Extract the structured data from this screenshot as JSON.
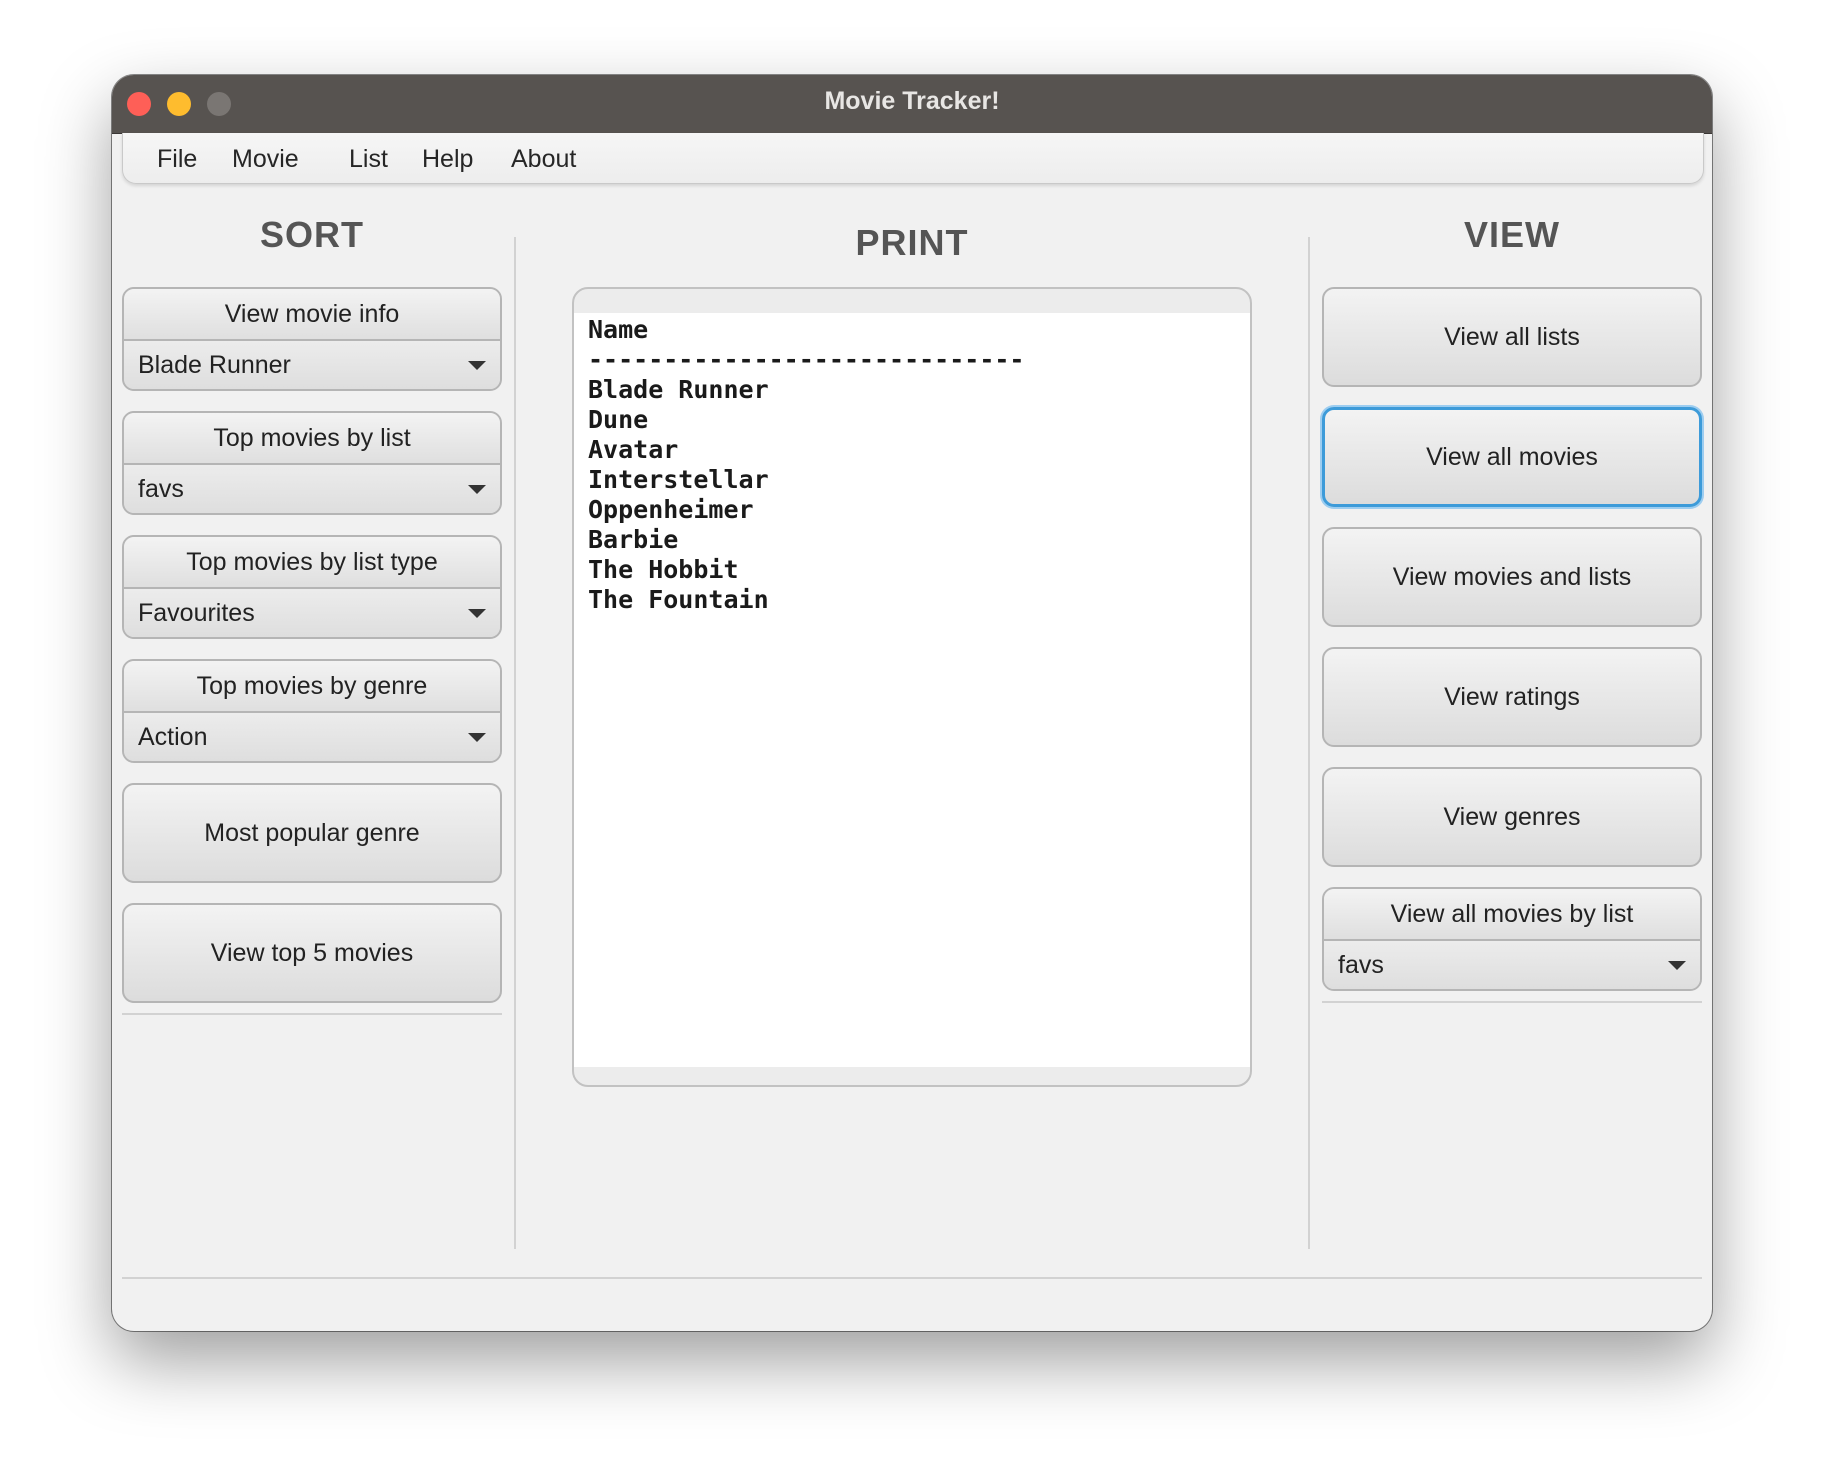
{
  "window": {
    "title": "Movie Tracker!"
  },
  "menu": {
    "items": [
      "File",
      "Movie",
      "List",
      "Help",
      "About"
    ]
  },
  "sort": {
    "title": "SORT",
    "view_movie_info": {
      "label": "View movie info",
      "selected": "Blade Runner"
    },
    "top_by_list": {
      "label": "Top movies by list",
      "selected": "favs"
    },
    "top_by_list_type": {
      "label": "Top movies by list type",
      "selected": "Favourites"
    },
    "top_by_genre": {
      "label": "Top movies by genre",
      "selected": "Action"
    },
    "most_popular_genre": "Most popular genre",
    "view_top5": "View top 5 movies"
  },
  "print": {
    "title": "PRINT",
    "header": "Name",
    "separator": "-----------------------------",
    "lines": [
      "Blade Runner",
      "Dune",
      "Avatar",
      "Interstellar",
      "Oppenheimer",
      "Barbie",
      "The Hobbit",
      "The Fountain"
    ]
  },
  "view": {
    "title": "VIEW",
    "view_all_lists": "View all lists",
    "view_all_movies": "View all movies",
    "view_movies_and_lists": "View movies and lists",
    "view_ratings": "View ratings",
    "view_genres": "View genres",
    "by_list": {
      "label": "View all movies by list",
      "selected": "favs"
    }
  }
}
